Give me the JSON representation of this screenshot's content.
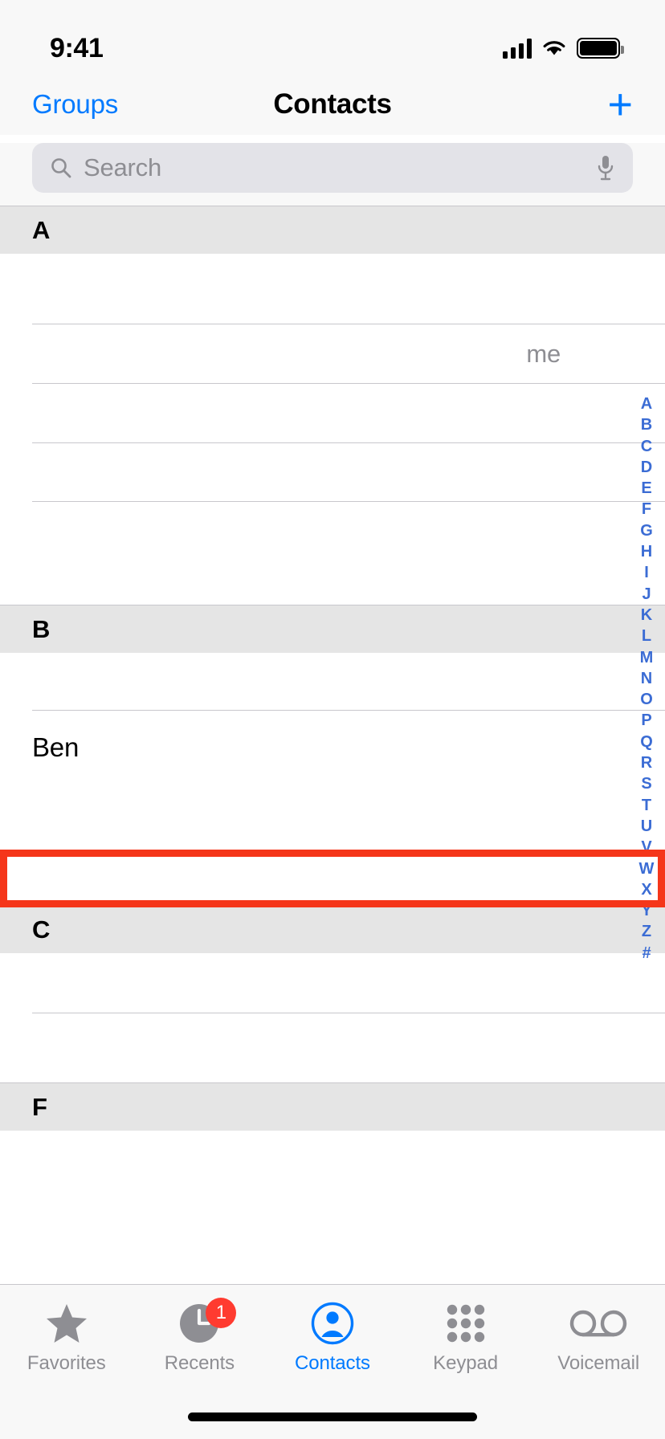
{
  "status_bar": {
    "time": "9:41",
    "cellular_icon": "cellular-signal-icon",
    "wifi_icon": "wifi-icon",
    "battery_icon": "battery-full-icon"
  },
  "nav_bar": {
    "left_button": "Groups",
    "title": "Contacts",
    "add_button": "+",
    "accent_color": "#007aff"
  },
  "search": {
    "placeholder": "Search",
    "value": "",
    "search_icon": "magnifier-icon",
    "dictation_icon": "microphone-icon"
  },
  "list": {
    "sections": [
      {
        "letter": "A",
        "rows": [
          {
            "name": "",
            "redacted": true,
            "accessory": ""
          },
          {
            "name": "",
            "redacted": true,
            "accessory": "me"
          },
          {
            "name": "",
            "redacted": true,
            "accessory": ""
          },
          {
            "name": "",
            "redacted": true,
            "accessory": ""
          },
          {
            "name": "",
            "redacted": true,
            "accessory": ""
          }
        ]
      },
      {
        "letter": "B",
        "rows": [
          {
            "name": "",
            "redacted": true,
            "accessory": ""
          },
          {
            "name": "Ben",
            "redacted": false,
            "accessory": "",
            "highlighted": true
          },
          {
            "name": "",
            "redacted": true,
            "accessory": ""
          }
        ]
      },
      {
        "letter": "C",
        "rows": [
          {
            "name": "",
            "redacted": true,
            "accessory": ""
          }
        ]
      },
      {
        "letter": "F",
        "rows": [
          {
            "name": "",
            "redacted": true,
            "accessory": ""
          }
        ]
      }
    ]
  },
  "index_bar": {
    "letters": [
      "A",
      "B",
      "C",
      "D",
      "E",
      "F",
      "G",
      "H",
      "I",
      "J",
      "K",
      "L",
      "M",
      "N",
      "O",
      "P",
      "Q",
      "R",
      "S",
      "T",
      "U",
      "V",
      "W",
      "X",
      "Y",
      "Z",
      "#"
    ],
    "color": "#3b6cd4"
  },
  "highlight": {
    "color": "#f5361a",
    "target_label": "Ben"
  },
  "tab_bar": {
    "tabs": [
      {
        "label": "Favorites",
        "icon": "star-icon",
        "active": false,
        "badge": ""
      },
      {
        "label": "Recents",
        "icon": "clock-icon",
        "active": false,
        "badge": "1"
      },
      {
        "label": "Contacts",
        "icon": "person-circle-icon",
        "active": true,
        "badge": ""
      },
      {
        "label": "Keypad",
        "icon": "keypad-grid-icon",
        "active": false,
        "badge": ""
      },
      {
        "label": "Voicemail",
        "icon": "voicemail-icon",
        "active": false,
        "badge": ""
      }
    ],
    "active_color": "#007aff",
    "inactive_color": "#8e8e93",
    "badge_color": "#ff3b30"
  },
  "home_indicator": "home-indicator-bar"
}
